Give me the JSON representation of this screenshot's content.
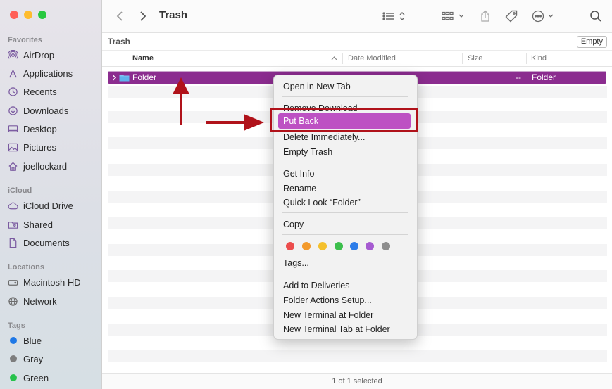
{
  "window": {
    "title": "Trash",
    "traffic_lights": [
      "#ff5f57",
      "#febc2e",
      "#28c840"
    ]
  },
  "sidebar": {
    "favorites_header": "Favorites",
    "favorites": [
      {
        "label": "AirDrop",
        "icon": "airdrop-icon"
      },
      {
        "label": "Applications",
        "icon": "applications-icon"
      },
      {
        "label": "Recents",
        "icon": "clock-icon"
      },
      {
        "label": "Downloads",
        "icon": "download-icon"
      },
      {
        "label": "Desktop",
        "icon": "desktop-icon"
      },
      {
        "label": "Pictures",
        "icon": "pictures-icon"
      },
      {
        "label": "joellockard",
        "icon": "home-icon"
      }
    ],
    "icloud_header": "iCloud",
    "icloud": [
      {
        "label": "iCloud Drive",
        "icon": "cloud-icon"
      },
      {
        "label": "Shared",
        "icon": "shared-folder-icon"
      },
      {
        "label": "Documents",
        "icon": "document-icon"
      }
    ],
    "locations_header": "Locations",
    "locations": [
      {
        "label": "Macintosh HD",
        "icon": "hard-drive-icon"
      },
      {
        "label": "Network",
        "icon": "globe-icon"
      }
    ],
    "tags_header": "Tags",
    "tags": [
      {
        "label": "Blue",
        "color": "#1f78e6"
      },
      {
        "label": "Gray",
        "color": "#7d7d7d"
      },
      {
        "label": "Green",
        "color": "#27c24c"
      }
    ]
  },
  "pathbar": {
    "label": "Trash",
    "empty_button": "Empty"
  },
  "columns": {
    "name": "Name",
    "date": "Date Modified",
    "size": "Size",
    "kind": "Kind"
  },
  "file_row": {
    "name": "Folder",
    "size": "--",
    "kind": "Folder"
  },
  "status": "1 of 1 selected",
  "context_menu": {
    "open_new_tab": "Open in New Tab",
    "remove_download": "Remove Download",
    "put_back": "Put Back",
    "delete_immediately": "Delete Immediately...",
    "empty_trash": "Empty Trash",
    "get_info": "Get Info",
    "rename": "Rename",
    "quick_look": "Quick Look “Folder”",
    "copy": "Copy",
    "tag_colors": [
      "#ec4d4d",
      "#f39a2c",
      "#f4c02c",
      "#3cbf4c",
      "#2d7de9",
      "#a65bd1",
      "#8e8e8e"
    ],
    "tags": "Tags...",
    "add_to_deliveries": "Add to Deliveries",
    "folder_actions": "Folder Actions Setup...",
    "new_terminal": "New Terminal at Folder",
    "new_terminal_tab": "New Terminal Tab at Folder"
  },
  "annotation_color": "#b0121a"
}
